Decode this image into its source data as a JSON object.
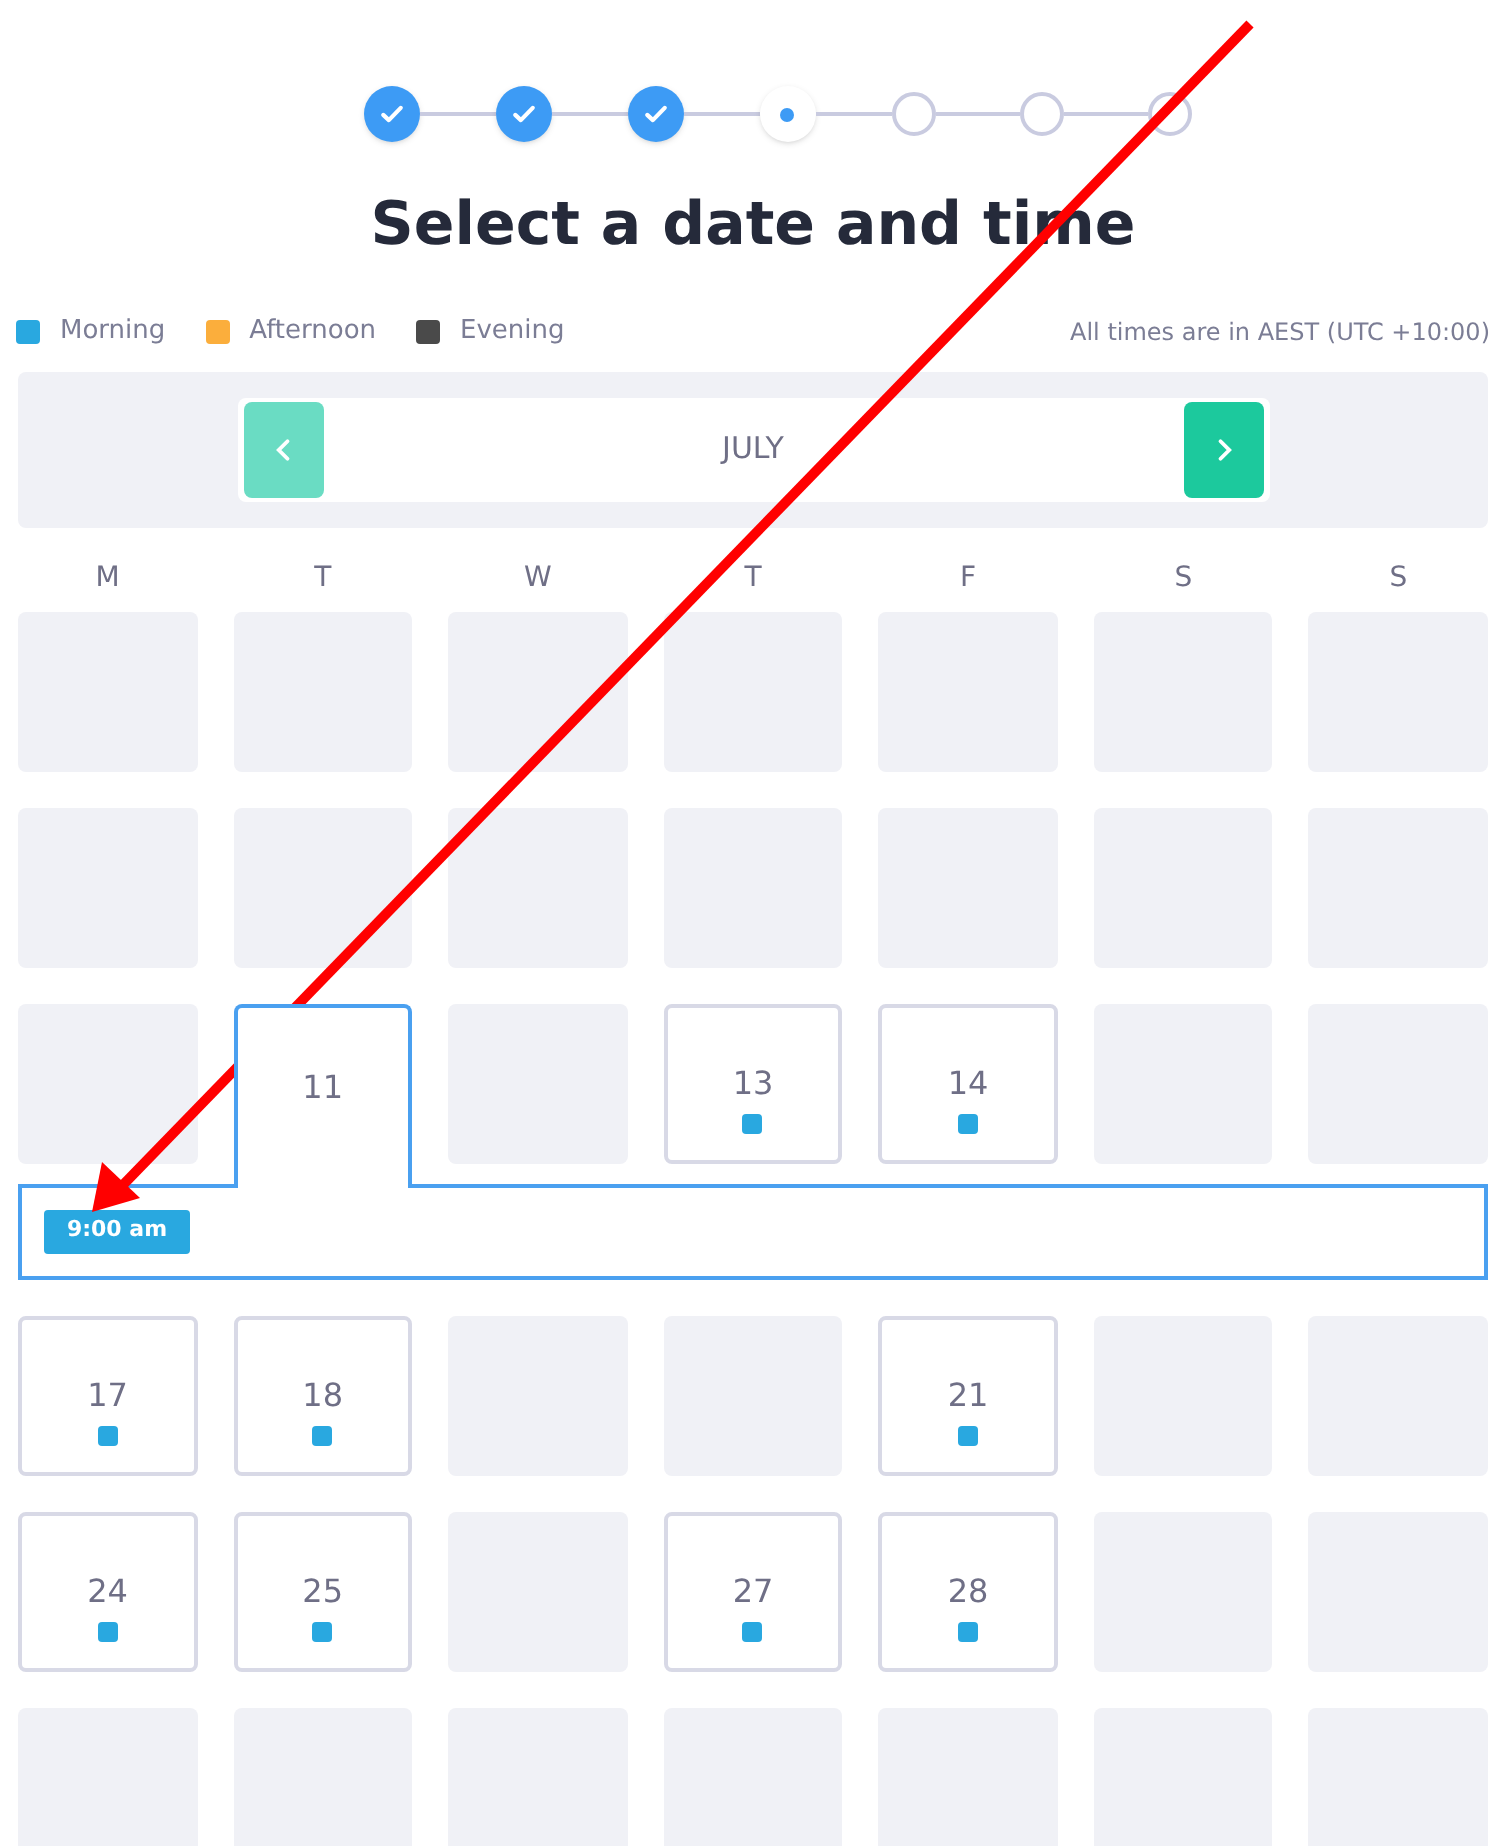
{
  "steps": [
    {
      "kind": "done"
    },
    {
      "kind": "done"
    },
    {
      "kind": "done"
    },
    {
      "kind": "current"
    },
    {
      "kind": "todo"
    },
    {
      "kind": "todo"
    },
    {
      "kind": "todo"
    }
  ],
  "title": "Select a date and time",
  "legend": [
    {
      "label": "Morning",
      "color": "#29a8e0"
    },
    {
      "label": "Afternoon",
      "color": "#fbae3c"
    },
    {
      "label": "Evening",
      "color": "#4a4a4a"
    }
  ],
  "timezone_note": "All times are in AEST (UTC +10:00)",
  "month": {
    "label": "JULY",
    "prev_enabled": false,
    "next_enabled": true
  },
  "weekdays": [
    "M",
    "T",
    "W",
    "T",
    "F",
    "S",
    "S"
  ],
  "weeks": [
    {
      "days": [
        {
          "available": false
        },
        {
          "available": false
        },
        {
          "available": false
        },
        {
          "available": false
        },
        {
          "available": false
        },
        {
          "available": false
        },
        {
          "available": false
        }
      ]
    },
    {
      "days": [
        {
          "available": false
        },
        {
          "available": false
        },
        {
          "available": false
        },
        {
          "available": false
        },
        {
          "available": false
        },
        {
          "available": false
        },
        {
          "available": false
        }
      ]
    },
    {
      "days": [
        {
          "available": false
        },
        {
          "available": true,
          "selected": true,
          "label": "11"
        },
        {
          "available": false
        },
        {
          "available": true,
          "selected": false,
          "label": "13",
          "color": "#29a8e0"
        },
        {
          "available": true,
          "selected": false,
          "label": "14",
          "color": "#29a8e0"
        },
        {
          "available": false
        },
        {
          "available": false
        }
      ],
      "slots": [
        {
          "label": "9:00 am",
          "color": "#29a8e0"
        }
      ]
    },
    {
      "days": [
        {
          "available": true,
          "selected": false,
          "label": "17",
          "color": "#29a8e0"
        },
        {
          "available": true,
          "selected": false,
          "label": "18",
          "color": "#29a8e0"
        },
        {
          "available": false
        },
        {
          "available": false
        },
        {
          "available": true,
          "selected": false,
          "label": "21",
          "color": "#29a8e0"
        },
        {
          "available": false
        },
        {
          "available": false
        }
      ]
    },
    {
      "days": [
        {
          "available": true,
          "selected": false,
          "label": "24",
          "color": "#29a8e0"
        },
        {
          "available": true,
          "selected": false,
          "label": "25",
          "color": "#29a8e0"
        },
        {
          "available": false
        },
        {
          "available": true,
          "selected": false,
          "label": "27",
          "color": "#29a8e0"
        },
        {
          "available": true,
          "selected": false,
          "label": "28",
          "color": "#29a8e0"
        },
        {
          "available": false
        },
        {
          "available": false
        }
      ]
    },
    {
      "days": [
        {
          "available": false
        },
        {
          "available": false
        },
        {
          "available": false
        },
        {
          "available": false
        },
        {
          "available": false
        },
        {
          "available": false
        },
        {
          "available": false
        }
      ]
    }
  ]
}
